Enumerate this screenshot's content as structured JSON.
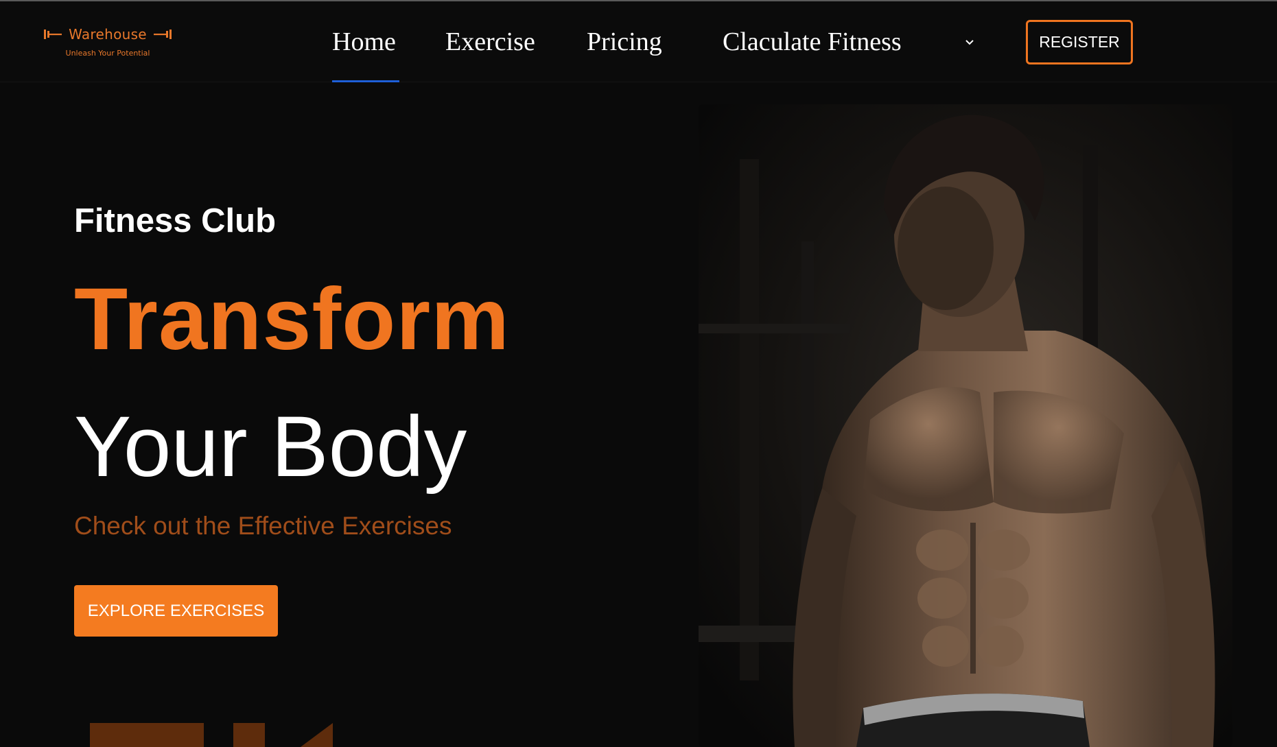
{
  "brand": {
    "name": "Warehouse",
    "tagline": "Unleash Your Potential",
    "accent_color": "#f07520",
    "logo_icon": "dumbbell-icon"
  },
  "nav": {
    "items": [
      {
        "label": "Home",
        "active": true
      },
      {
        "label": "Exercise",
        "active": false
      },
      {
        "label": "Pricing",
        "active": false
      },
      {
        "label": "Claculate Fitness",
        "active": false
      }
    ],
    "dropdown_icon": "chevron-down-icon",
    "register_label": "REGISTER",
    "active_indicator_color": "#1e5fd8"
  },
  "hero": {
    "eyebrow": "Fitness Club",
    "headline_line1": "Transform",
    "headline_line2": "Your Body",
    "subtitle": "Check out the Effective Exercises",
    "cta_label": "EXPLORE EXERCISES",
    "image_subject": "muscular-man-gym-photo"
  }
}
